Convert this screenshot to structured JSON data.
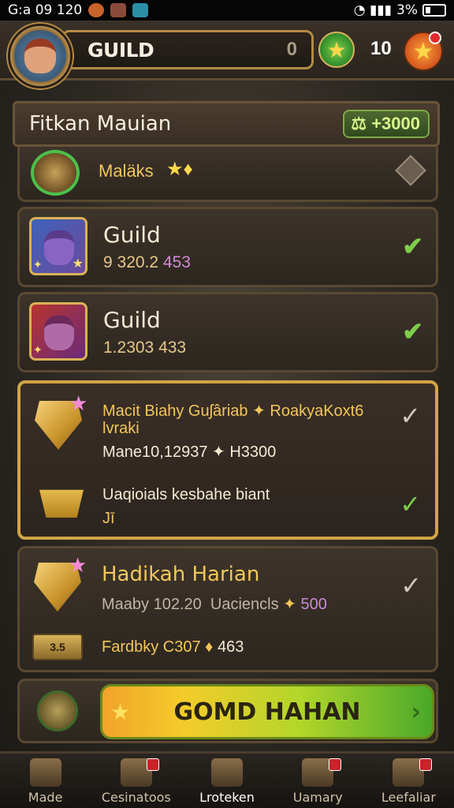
{
  "status_bar": {
    "time": "G:a 09 120",
    "battery": "3%"
  },
  "header": {
    "title": "GUILD",
    "zero": "0",
    "coin_count": "10"
  },
  "section": {
    "title": "Fitkan Mauian",
    "reward": "⚖ +3000"
  },
  "rows": {
    "partial": {
      "label": "Maläks"
    },
    "guild_1": {
      "name": "Guild",
      "value_a": "9 320.2",
      "value_b": "453"
    },
    "guild_2": {
      "name": "Guild",
      "value_a": "1.2303",
      "value_b": "433"
    }
  },
  "quest_card_1": {
    "title": "Macit Biahy Guʃâriab ✦ RoakyaKoxt6",
    "title_line2": "lvraki",
    "progress": "Mane10,12937 ✦ H3300",
    "item2_title": "Uaqioials kesbahe biant",
    "item2_sub": "Jī"
  },
  "quest_card_2": {
    "title": "Hadikah Harian",
    "sub": "Maaby 102.20",
    "sub_b": "Uaciencls",
    "sub_c": "500",
    "line3": "Fardbky C307",
    "line3_b": "463",
    "ticket_text": "3.5"
  },
  "action": {
    "button_label": "GOMD HAHAN"
  },
  "bottom_nav": [
    {
      "label": "Made"
    },
    {
      "label": "Cesinatoos"
    },
    {
      "label": "Lroteken"
    },
    {
      "label": "Uamary"
    },
    {
      "label": "Leefaliar"
    }
  ]
}
